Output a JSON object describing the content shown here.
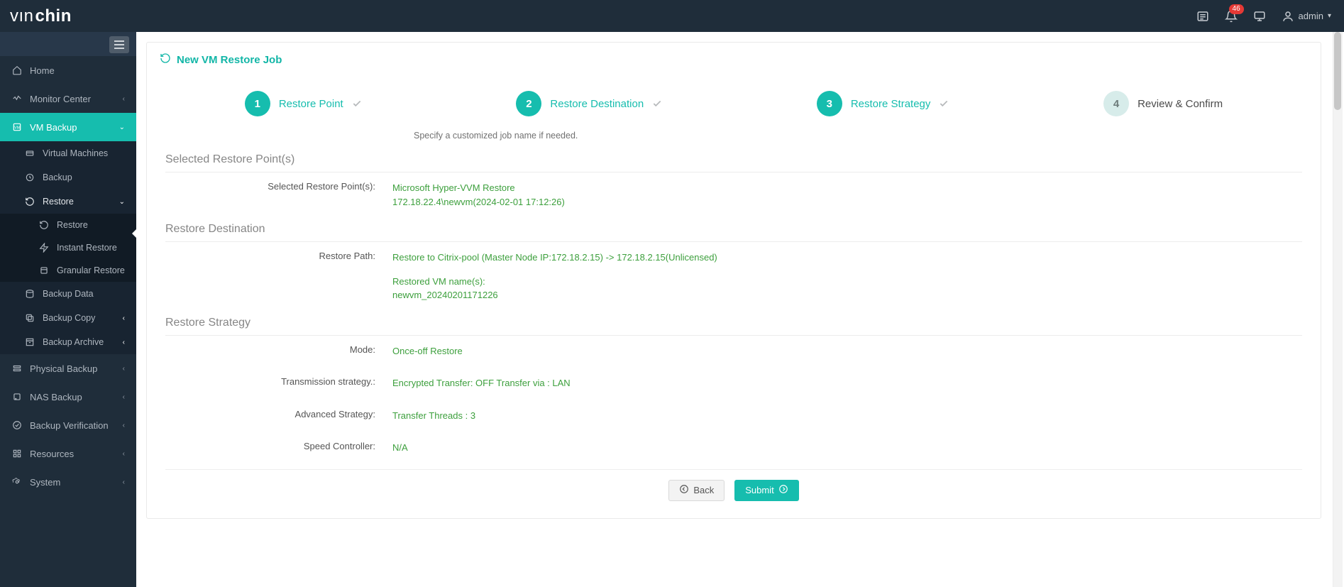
{
  "brand": {
    "part1": "vın",
    "part2": "chin"
  },
  "top": {
    "notification_count": "46",
    "user_label": "admin"
  },
  "sidebar": {
    "items": [
      {
        "label": "Home"
      },
      {
        "label": "Monitor Center"
      },
      {
        "label": "VM Backup",
        "children": [
          {
            "label": "Virtual Machines"
          },
          {
            "label": "Backup"
          },
          {
            "label": "Restore",
            "children": [
              {
                "label": "Restore"
              },
              {
                "label": "Instant Restore"
              },
              {
                "label": "Granular Restore"
              }
            ]
          },
          {
            "label": "Backup Data"
          },
          {
            "label": "Backup Copy"
          },
          {
            "label": "Backup Archive"
          }
        ]
      },
      {
        "label": "Physical Backup"
      },
      {
        "label": "NAS Backup"
      },
      {
        "label": "Backup Verification"
      },
      {
        "label": "Resources"
      },
      {
        "label": "System"
      }
    ]
  },
  "page": {
    "title": "New VM Restore Job",
    "job_hint": "Specify a customized job name if needed.",
    "steps": [
      {
        "num": "1",
        "label": "Restore Point"
      },
      {
        "num": "2",
        "label": "Restore Destination"
      },
      {
        "num": "3",
        "label": "Restore Strategy"
      },
      {
        "num": "4",
        "label": "Review & Confirm"
      }
    ],
    "section1_title": "Selected Restore Point(s)",
    "selected_point_label": "Selected Restore Point(s):",
    "selected_point_value_l1": "Microsoft Hyper-VVM Restore",
    "selected_point_value_l2": "172.18.22.4\\newvm(2024-02-01 17:12:26)",
    "section2_title": "Restore Destination",
    "restore_path_label": "Restore Path:",
    "restore_path_value": "Restore to Citrix-pool (Master Node IP:172.18.2.15) -> 172.18.2.15(Unlicensed)",
    "restored_vm_names_label": "Restored VM name(s):",
    "restored_vm_names_value": "newvm_20240201171226",
    "section3_title": "Restore Strategy",
    "mode_label": "Mode:",
    "mode_value": "Once-off Restore",
    "trans_label": "Transmission strategy.:",
    "trans_value": "Encrypted Transfer: OFF Transfer via : LAN",
    "adv_label": "Advanced Strategy:",
    "adv_value": "Transfer Threads : 3",
    "speed_label": "Speed Controller:",
    "speed_value": "N/A",
    "back_btn": "Back",
    "submit_btn": "Submit"
  }
}
